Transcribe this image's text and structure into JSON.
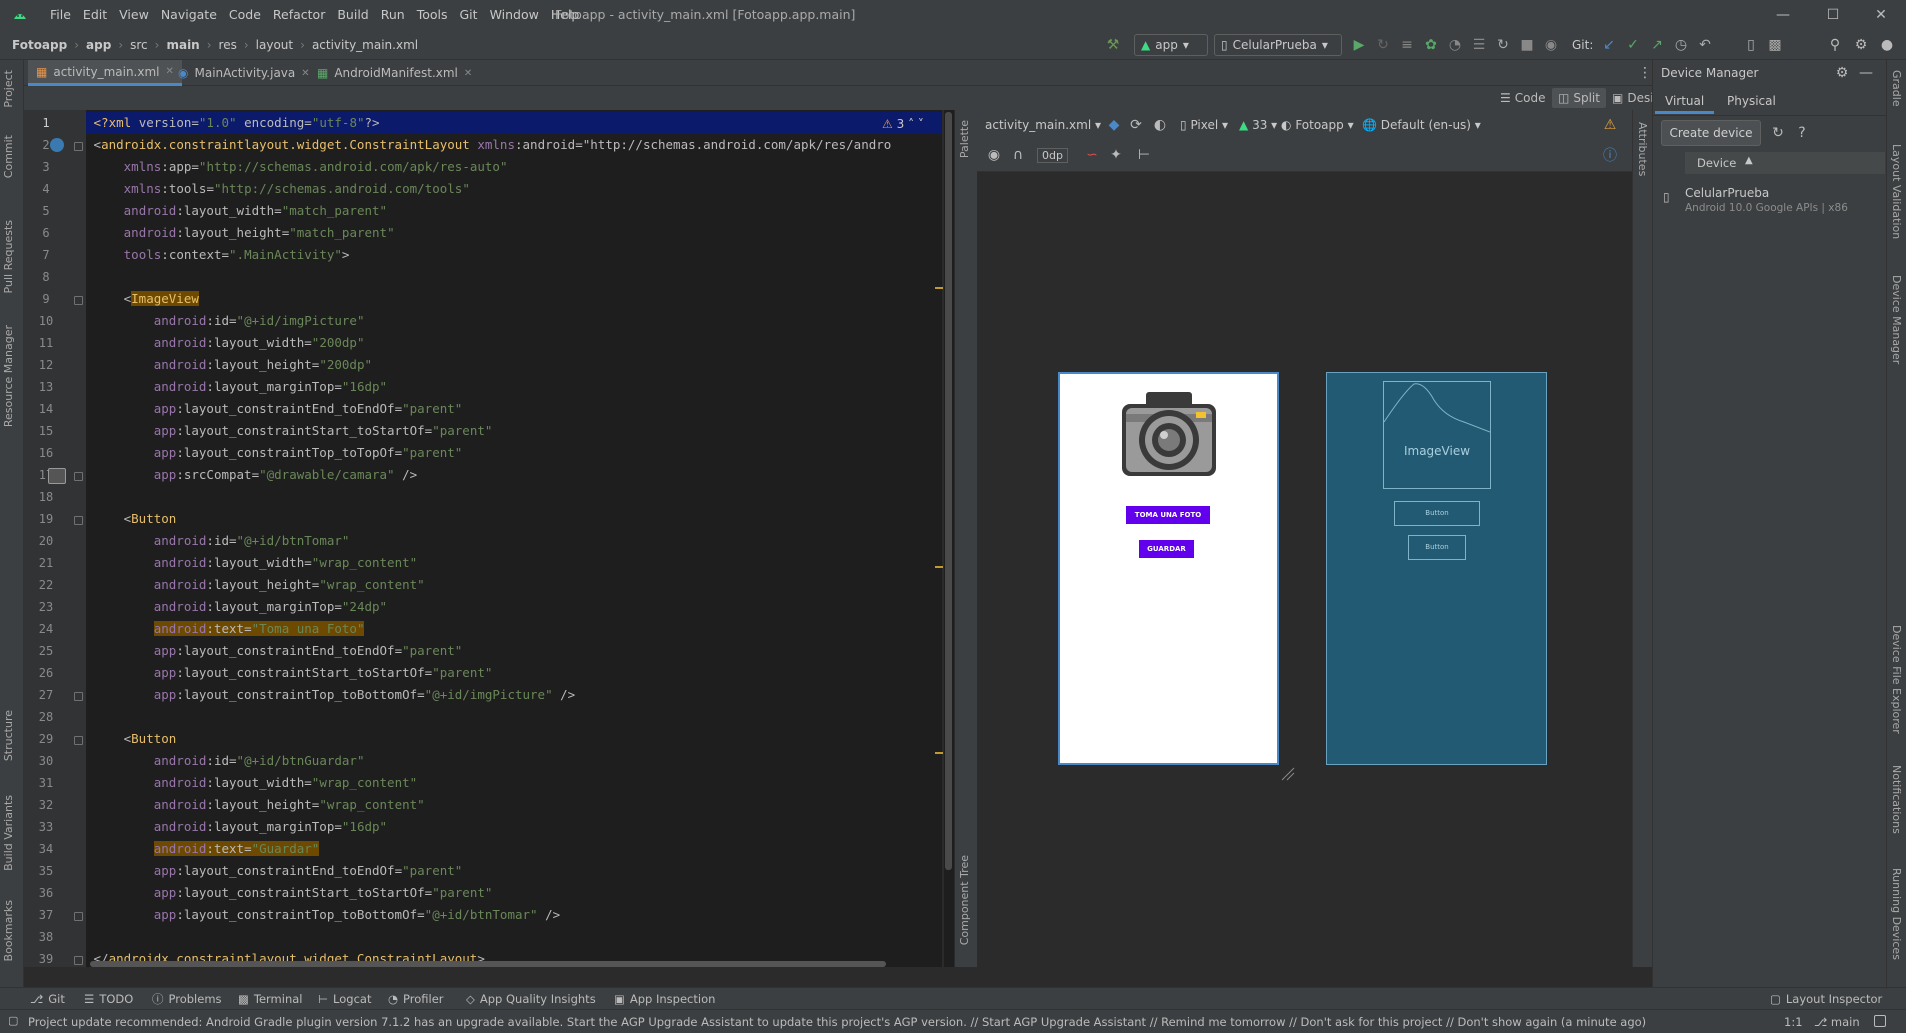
{
  "menu": [
    "File",
    "Edit",
    "View",
    "Navigate",
    "Code",
    "Refactor",
    "Build",
    "Run",
    "Tools",
    "Git",
    "Window",
    "Help"
  ],
  "window_title": "Fotoapp - activity_main.xml [Fotoapp.app.main]",
  "breadcrumbs": [
    "Fotoapp",
    "app",
    "src",
    "main",
    "res",
    "layout",
    "activity_main.xml"
  ],
  "toolbar": {
    "run_config": "app",
    "device": "CelularPrueba",
    "git_label": "Git:"
  },
  "tabs": [
    {
      "label": "activity_main.xml",
      "active": true
    },
    {
      "label": "MainActivity.java",
      "active": false
    },
    {
      "label": "AndroidManifest.xml",
      "active": false
    }
  ],
  "view_modes": [
    "Code",
    "Split",
    "Design"
  ],
  "warnings_count": "3",
  "code_lines": [
    "<?xml version=\"1.0\" encoding=\"utf-8\"?>",
    "<androidx.constraintlayout.widget.ConstraintLayout xmlns:android=\"http://schemas.android.com/apk/res/andro",
    "    xmlns:app=\"http://schemas.android.com/apk/res-auto\"",
    "    xmlns:tools=\"http://schemas.android.com/tools\"",
    "    android:layout_width=\"match_parent\"",
    "    android:layout_height=\"match_parent\"",
    "    tools:context=\".MainActivity\">",
    "",
    "    <ImageView",
    "        android:id=\"@+id/imgPicture\"",
    "        android:layout_width=\"200dp\"",
    "        android:layout_height=\"200dp\"",
    "        android:layout_marginTop=\"16dp\"",
    "        app:layout_constraintEnd_toEndOf=\"parent\"",
    "        app:layout_constraintStart_toStartOf=\"parent\"",
    "        app:layout_constraintTop_toTopOf=\"parent\"",
    "        app:srcCompat=\"@drawable/camara\" />",
    "",
    "    <Button",
    "        android:id=\"@+id/btnTomar\"",
    "        android:layout_width=\"wrap_content\"",
    "        android:layout_height=\"wrap_content\"",
    "        android:layout_marginTop=\"24dp\"",
    "        android:text=\"Toma una Foto\"",
    "        app:layout_constraintEnd_toEndOf=\"parent\"",
    "        app:layout_constraintStart_toStartOf=\"parent\"",
    "        app:layout_constraintTop_toBottomOf=\"@+id/imgPicture\" />",
    "",
    "    <Button",
    "        android:id=\"@+id/btnGuardar\"",
    "        android:layout_width=\"wrap_content\"",
    "        android:layout_height=\"wrap_content\"",
    "        android:layout_marginTop=\"16dp\"",
    "        android:text=\"Guardar\"",
    "        app:layout_constraintEnd_toEndOf=\"parent\"",
    "        app:layout_constraintStart_toStartOf=\"parent\"",
    "        app:layout_constraintTop_toBottomOf=\"@+id/btnTomar\" />",
    "",
    "</androidx.constraintlayout.widget.ConstraintLayout>"
  ],
  "design_toolbar": {
    "file": "activity_main.xml",
    "device": "Pixel",
    "api": "33",
    "theme": "Fotoapp",
    "locale": "Default (en-us)",
    "margin": "0dp"
  },
  "preview": {
    "btn_take": "TOMA UNA FOTO",
    "btn_save": "GUARDAR",
    "blueprint_image": "ImageView",
    "blueprint_btn": "Button"
  },
  "side_labels": {
    "palette": "Palette",
    "component_tree": "Component Tree",
    "attributes": "Attributes"
  },
  "left_tools": [
    "Project",
    "Commit",
    "Pull Requests",
    "Resource Manager",
    "Structure",
    "Build Variants",
    "Bookmarks"
  ],
  "right_tools": [
    "Gradle",
    "Layout Validation",
    "Device Manager",
    "Device File Explorer",
    "Notifications",
    "Running Devices"
  ],
  "device_manager": {
    "title": "Device Manager",
    "tabs": [
      "Virtual",
      "Physical"
    ],
    "create_button": "Create device",
    "column": "Device",
    "devices": [
      {
        "name": "CelularPrueba",
        "detail": "Android 10.0 Google APIs | x86"
      }
    ]
  },
  "bottom_tools": [
    "Git",
    "TODO",
    "Problems",
    "Terminal",
    "Logcat",
    "Profiler",
    "App Quality Insights",
    "App Inspection"
  ],
  "layout_inspector": "Layout Inspector",
  "status": {
    "message": "Project update recommended: Android Gradle plugin version 7.1.2 has an upgrade available. Start the AGP Upgrade Assistant to update this project's AGP version. // Start AGP Upgrade Assistant // Remind me tomorrow // Don't ask for this project // Don't show again (a minute ago)",
    "position": "1:1",
    "branch": "main"
  },
  "colors": {
    "accent": "#4a88c7",
    "button_purple": "#6200ee",
    "blueprint": "#235a73"
  }
}
